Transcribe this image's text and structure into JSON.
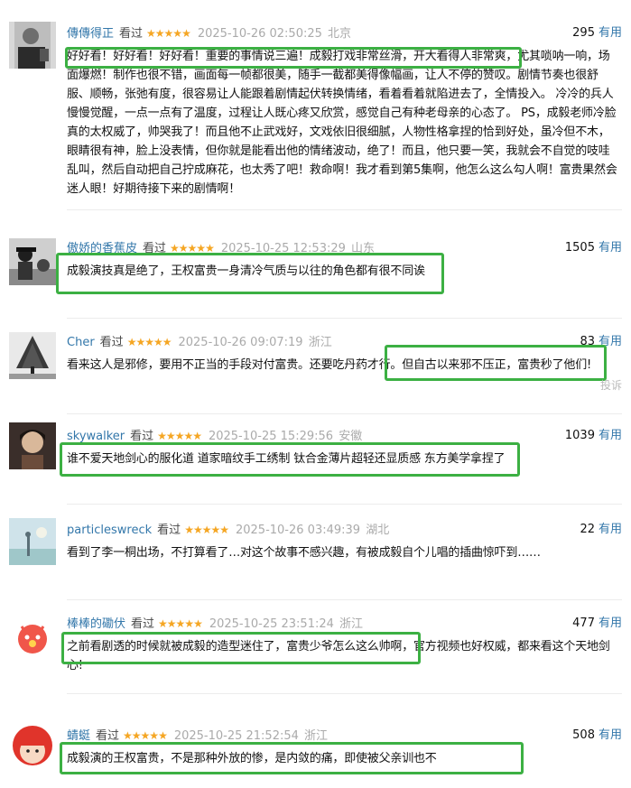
{
  "vote_useful_label": "有用",
  "reviews": [
    {
      "user": "傳傳得正",
      "status": "看过",
      "stars": "★★★★★",
      "time": "2025-10-26 02:50:25",
      "location": "北京",
      "votes": "295",
      "text": "好好看！好好看！好好看！重要的事情说三遍！成毅打戏非常丝滑，开大看得人非常爽，尤其唢呐一响，场面爆燃！制作也很不错，画面每一帧都很美，随手一截都美得像幅画，让人不停的赞叹。剧情节奏也很舒服、顺畅，张弛有度，很容易让人能跟着剧情起伏转换情绪，看着看着就陷进去了，全情投入。 冷冷的兵人慢慢觉醒，一点一点有了温度，过程让人既心疼又欣赏，感觉自己有种老母亲的心态了。 PS，成毅老师冷脸真的太权威了，帅哭我了！而且他不止武戏好，文戏依旧很细腻，人物性格拿捏的恰到好处，虽冷但不木，眼睛很有神，脸上没表情，但你就是能看出他的情绪波动，绝了！而且，他只要一笑，我就会不自觉的吱哇乱叫，然后自动把自己拧成麻花，也太秀了吧！救命啊！我才看到第5集啊，他怎么这么勾人啊！富贵果然会迷人眼！好期待接下来的剧情啊！"
    },
    {
      "user": "傲娇的香蕉皮",
      "status": "看过",
      "stars": "★★★★★",
      "time": "2025-10-25 12:53:29",
      "location": "山东",
      "votes": "1505",
      "text": "成毅演技真是绝了，王权富贵一身清冷气质与以往的角色都有很不同诶"
    },
    {
      "user": "Cher",
      "status": "看过",
      "stars": "★★★★★",
      "time": "2025-10-26 09:07:19",
      "location": "浙江",
      "votes": "83",
      "text": "看来这人是邪修，要用不正当的手段对付富贵。还要吃丹药才行。但自古以来邪不压正，富贵秒了他们!",
      "report": "投诉"
    },
    {
      "user": "skywalker",
      "status": "看过",
      "stars": "★★★★★",
      "time": "2025-10-25 15:29:56",
      "location": "安徽",
      "votes": "1039",
      "text": "谁不爱天地剑心的服化道 道家暗纹手工绣制 钛合金薄片超轻还显质感 东方美学拿捏了"
    },
    {
      "user": "particleswreck",
      "status": "看过",
      "stars": "★★★★★",
      "time": "2025-10-26 03:49:39",
      "location": "湖北",
      "votes": "22",
      "text": "看到了李一桐出场，不打算看了…对这个故事不感兴趣，有被成毅自个儿唱的插曲惊吓到……"
    },
    {
      "user": "棒棒的磡伏",
      "status": "看过",
      "stars": "★★★★★",
      "time": "2025-10-25 23:51:24",
      "location": "浙江",
      "votes": "477",
      "text": "之前看剧透的时候就被成毅的造型迷住了，富贵少爷怎么这么帅啊，官方视频也好权威，都来看这个天地剑心!"
    },
    {
      "user": "蜻蜓",
      "status": "看过",
      "stars": "★★★★★",
      "time": "2025-10-25 21:52:54",
      "location": "浙江",
      "votes": "508",
      "text": "成毅演的王权富贵，不是那种外放的惨，是内敛的痛，即使被父亲训也不"
    }
  ]
}
